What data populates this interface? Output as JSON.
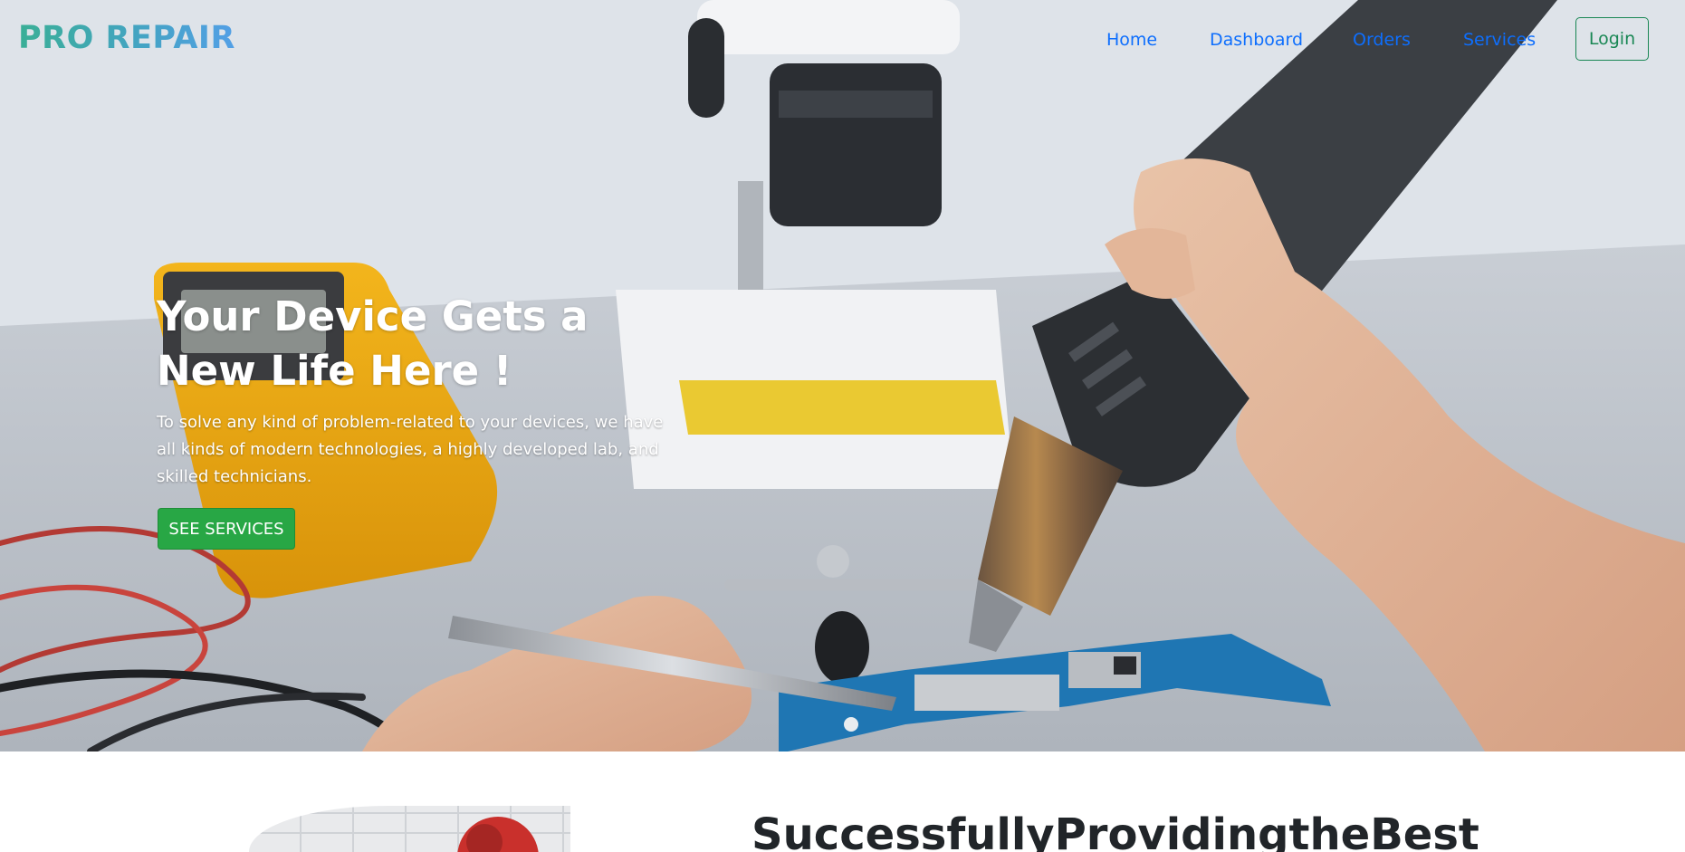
{
  "navbar": {
    "brand": "PRO REPAIR",
    "links": [
      {
        "label": "Home"
      },
      {
        "label": "Dashboard"
      },
      {
        "label": "Orders"
      },
      {
        "label": "Services"
      }
    ],
    "login_label": "Login",
    "colors": {
      "link": "#0d6efd",
      "login": "#198754",
      "brand_from": "#3aaf96",
      "brand_to": "#53a0e6"
    }
  },
  "hero": {
    "title_line1": "Your Device Gets a",
    "title_line2": "New Life Here !",
    "description": "To solve any kind of problem-related to your devices, we have all kinds of modern technologies, a highly developed lab, and skilled technicians.",
    "cta_label": "SEE SERVICES",
    "cta_color": "#28a745",
    "background_image": "technician soldering a phone circuit board with multimeter and microscope"
  },
  "about": {
    "title_words": [
      "Successfully",
      "Providing",
      "the",
      "Best"
    ]
  }
}
